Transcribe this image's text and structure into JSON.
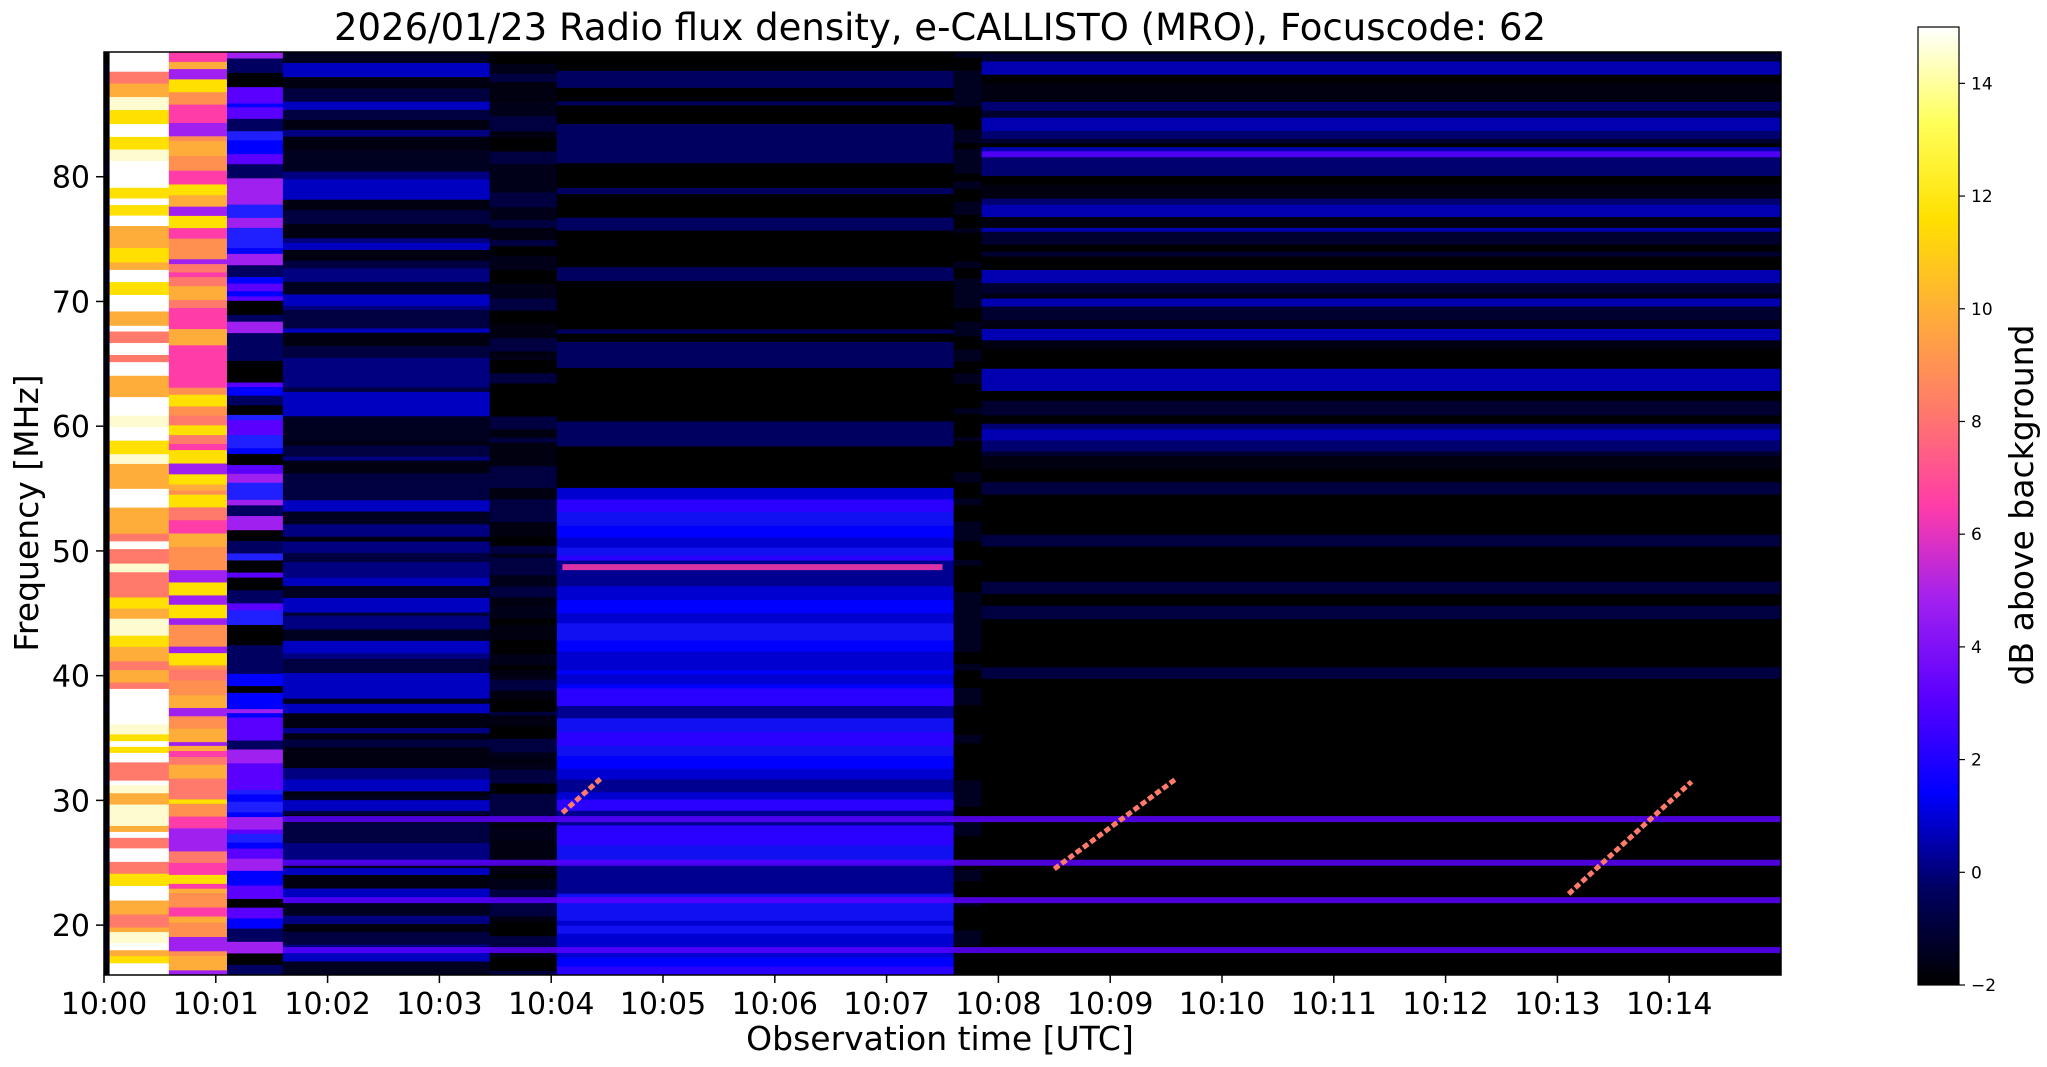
{
  "chart_data": {
    "type": "heatmap",
    "title": "2026/01/23  Radio flux density, e-CALLISTO (MRO), Focuscode: 62",
    "xlabel": "Observation time [UTC]",
    "ylabel": "Frequency [MHz]",
    "colorbar_label": "dB above background",
    "xlim_minutes": [
      0,
      15
    ],
    "x_tick_labels": [
      "10:00",
      "10:01",
      "10:02",
      "10:03",
      "10:04",
      "10:05",
      "10:06",
      "10:07",
      "10:08",
      "10:09",
      "10:10",
      "10:11",
      "10:12",
      "10:13",
      "10:14"
    ],
    "x_tick_minutes": [
      0,
      1,
      2,
      3,
      4,
      5,
      6,
      7,
      8,
      9,
      10,
      11,
      12,
      13,
      14
    ],
    "ylim": [
      16,
      90
    ],
    "y_ticks": [
      20,
      30,
      40,
      50,
      60,
      70,
      80
    ],
    "clim": [
      -2,
      15
    ],
    "colorbar_ticks": [
      -2,
      0,
      2,
      4,
      6,
      8,
      10,
      12,
      14
    ],
    "colormap": "gnuplot2",
    "colormap_stops": [
      "#000000",
      "#000060",
      "#0000ff",
      "#5a00ff",
      "#a020f0",
      "#ff3ca8",
      "#ff7a6a",
      "#ffad3a",
      "#ffe000",
      "#ffff5a",
      "#ffffff"
    ],
    "time_segments": [
      {
        "start": 0.0,
        "end": 0.05,
        "level": "black"
      },
      {
        "start": 0.05,
        "end": 0.58,
        "level": "saturated-white-yellow"
      },
      {
        "start": 0.58,
        "end": 1.1,
        "level": "orange-pink"
      },
      {
        "start": 1.1,
        "end": 1.6,
        "level": "blue-violet"
      },
      {
        "start": 1.6,
        "end": 3.45,
        "level": "dark-blue"
      },
      {
        "start": 3.45,
        "end": 4.05,
        "level": "mostly-dark"
      },
      {
        "start": 4.05,
        "end": 7.6,
        "level": "blue"
      },
      {
        "start": 7.6,
        "end": 7.85,
        "level": "dark"
      },
      {
        "start": 7.85,
        "end": 15.0,
        "level": "dark-upper-banded"
      }
    ],
    "features": [
      {
        "name": "continuum line",
        "freq_mhz": 48.7,
        "t_start": 4.1,
        "t_end": 7.5
      },
      {
        "name": "band",
        "freq_mhz": 28.5,
        "t_start": 1.6,
        "t_end": 15.0
      },
      {
        "name": "band",
        "freq_mhz": 25.0,
        "t_start": 1.6,
        "t_end": 15.0
      },
      {
        "name": "band",
        "freq_mhz": 22.0,
        "t_start": 1.6,
        "t_end": 15.0
      },
      {
        "name": "band",
        "freq_mhz": 18.0,
        "t_start": 1.6,
        "t_end": 15.0
      },
      {
        "name": "band",
        "freq_mhz": 81.8,
        "t_start": 7.85,
        "t_end": 15.0
      }
    ],
    "drifting_bursts": [
      {
        "t_start": 4.1,
        "f_start": 29.0,
        "t_end": 4.45,
        "f_end": 31.8
      },
      {
        "t_start": 8.5,
        "f_start": 24.5,
        "t_end": 9.6,
        "f_end": 31.8
      },
      {
        "t_start": 13.1,
        "f_start": 22.5,
        "t_end": 14.2,
        "f_end": 31.5
      }
    ]
  }
}
